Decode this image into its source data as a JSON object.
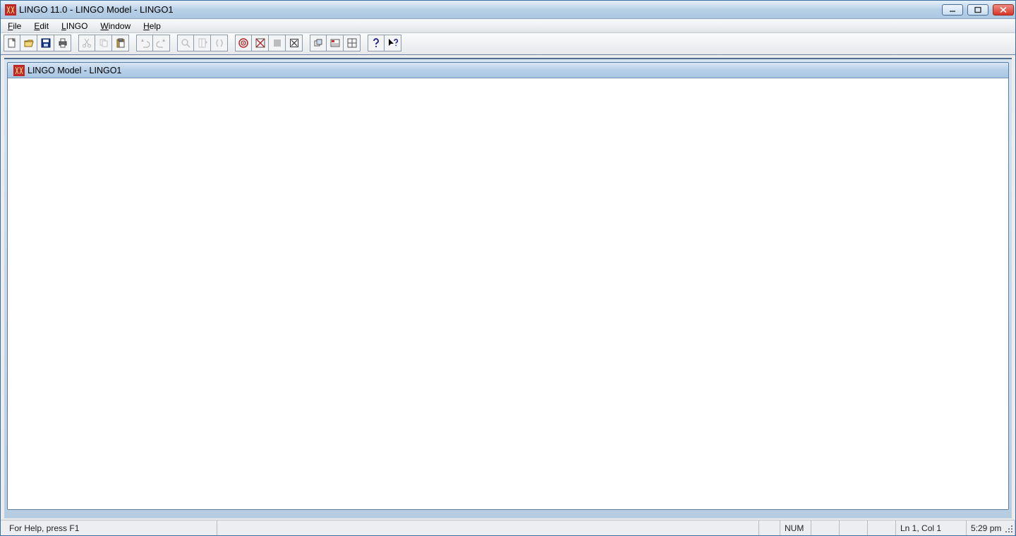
{
  "title": "LINGO 11.0 - LINGO Model - LINGO1",
  "menu": {
    "file": "File",
    "edit": "Edit",
    "lingo": "LINGO",
    "window": "Window",
    "help": "Help"
  },
  "toolbar_names": {
    "new": "new",
    "open": "open",
    "save": "save",
    "print": "print",
    "cut": "cut",
    "copy": "copy",
    "paste": "paste",
    "undo": "undo",
    "redo": "redo",
    "find": "find",
    "goto": "goto-line",
    "brackets": "match-brackets",
    "solve": "solve",
    "solution": "solution",
    "stop": "interrupt",
    "close": "close-all",
    "opt1": "send-to-back",
    "opt2": "options",
    "opt3": "tile-windows",
    "help": "help-topics",
    "context": "context-help"
  },
  "child_title": "LINGO Model - LINGO1",
  "status": {
    "help": "For Help, press F1",
    "numlock": "NUM",
    "pos": "Ln 1, Col 1",
    "time": "5:29 pm"
  }
}
